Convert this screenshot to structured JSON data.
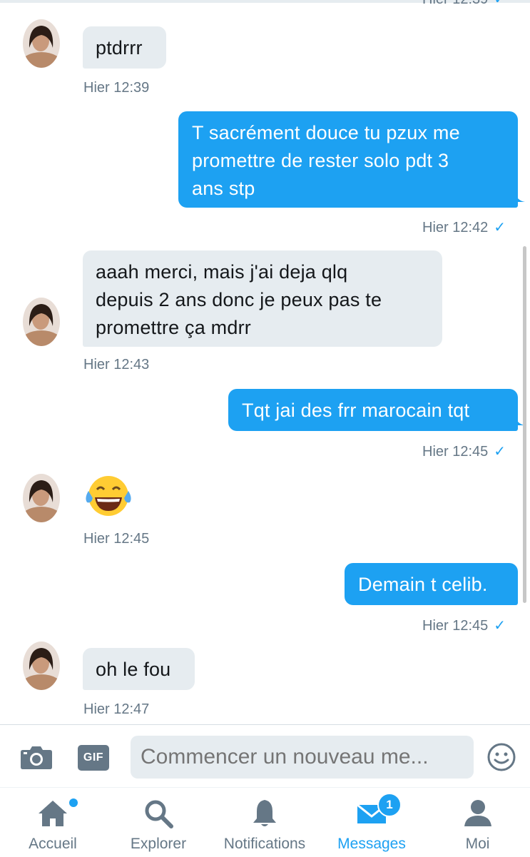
{
  "thread": {
    "top_partial_timestamp": "Hier 12:39",
    "messages": [
      {
        "direction": "in",
        "text": "ptdrrr",
        "time": "Hier 12:39"
      },
      {
        "direction": "out",
        "lines": [
          "T sacrément douce tu pzux me",
          "promettre de rester solo pdt 3",
          "ans stp"
        ],
        "time": "Hier 12:42",
        "read": true
      },
      {
        "direction": "in",
        "lines": [
          "aaah merci, mais j'ai deja qlq",
          "depuis 2 ans donc je peux pas te",
          "promettre ça mdrr"
        ],
        "time": "Hier 12:43"
      },
      {
        "direction": "out",
        "text": "Tqt jai des frr marocain tqt",
        "time": "Hier 12:45",
        "read": true
      },
      {
        "direction": "in",
        "emoji": "face-with-tears-of-joy",
        "time": "Hier 12:45"
      },
      {
        "direction": "out",
        "text": "Demain t celib.",
        "time": "Hier 12:45",
        "read": true
      },
      {
        "direction": "in",
        "text": "oh le fou",
        "time": "Hier 12:47"
      }
    ]
  },
  "composer": {
    "placeholder": "Commencer un nouveau me...",
    "gif_label": "GIF",
    "camera_icon": "camera-icon",
    "emoji_icon": "emoji-icon"
  },
  "tabbar": {
    "tabs": [
      {
        "label": "Accueil",
        "icon": "home-icon",
        "has_dot": true
      },
      {
        "label": "Explorer",
        "icon": "search-icon"
      },
      {
        "label": "Notifications",
        "icon": "bell-icon"
      },
      {
        "label": "Messages",
        "icon": "envelope-icon",
        "active": true,
        "badge": "1"
      },
      {
        "label": "Moi",
        "icon": "person-icon"
      }
    ]
  },
  "colors": {
    "accent": "#1da1f2",
    "incoming_bubble": "#e6ecf0",
    "muted_text": "#657786"
  }
}
